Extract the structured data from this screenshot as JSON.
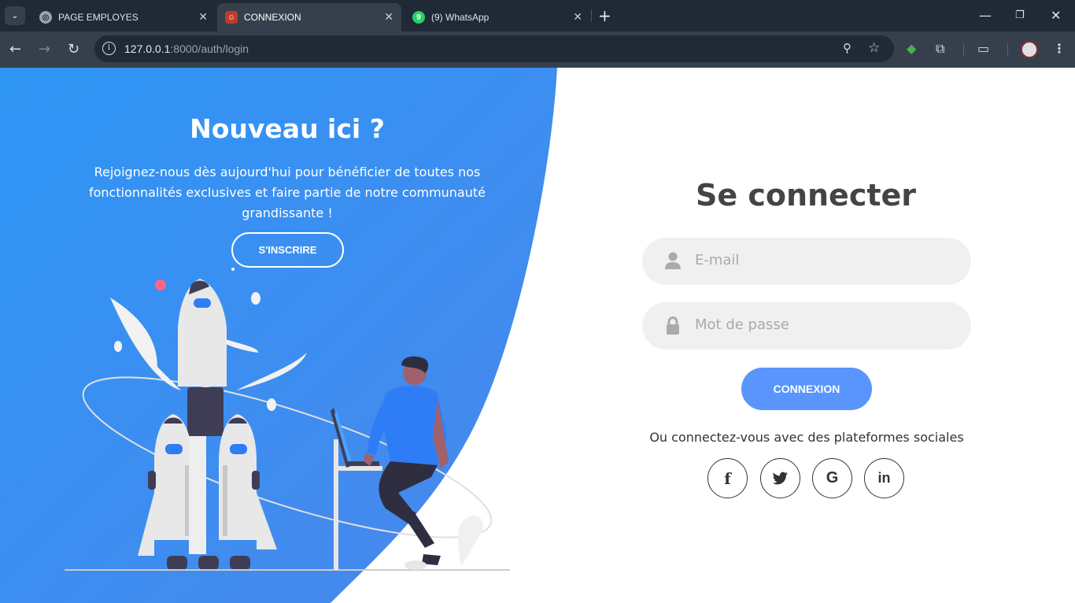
{
  "browser": {
    "tabs": [
      {
        "title": "PAGE EMPLOYES",
        "active": false
      },
      {
        "title": "CONNEXION",
        "active": true
      },
      {
        "title": "(9) WhatsApp",
        "active": false,
        "badge": "9"
      }
    ],
    "new_tab_icon": "plus-icon",
    "url": {
      "host": "127.0.0.1",
      "rest": ":8000/auth/login"
    }
  },
  "left": {
    "title": "Nouveau ici ?",
    "text": "Rejoignez-nous dès aujourd'hui pour bénéficier de toutes nos fonctionnalités exclusives et faire partie de notre communauté grandissante !",
    "signup_label": "S'INSCRIRE",
    "background_color": "#3b93f4"
  },
  "right": {
    "title": "Se connecter",
    "email_placeholder": "E-mail",
    "password_placeholder": "Mot de passe",
    "login_label": "CONNEXION",
    "social_text": "Ou connectez-vous avec des plateformes sociales",
    "socials": [
      {
        "name": "facebook",
        "glyph": "f"
      },
      {
        "name": "twitter",
        "glyph": "🐦"
      },
      {
        "name": "google",
        "glyph": "G"
      },
      {
        "name": "linkedin",
        "glyph": "in"
      }
    ],
    "accent_color": "#5995fd"
  }
}
